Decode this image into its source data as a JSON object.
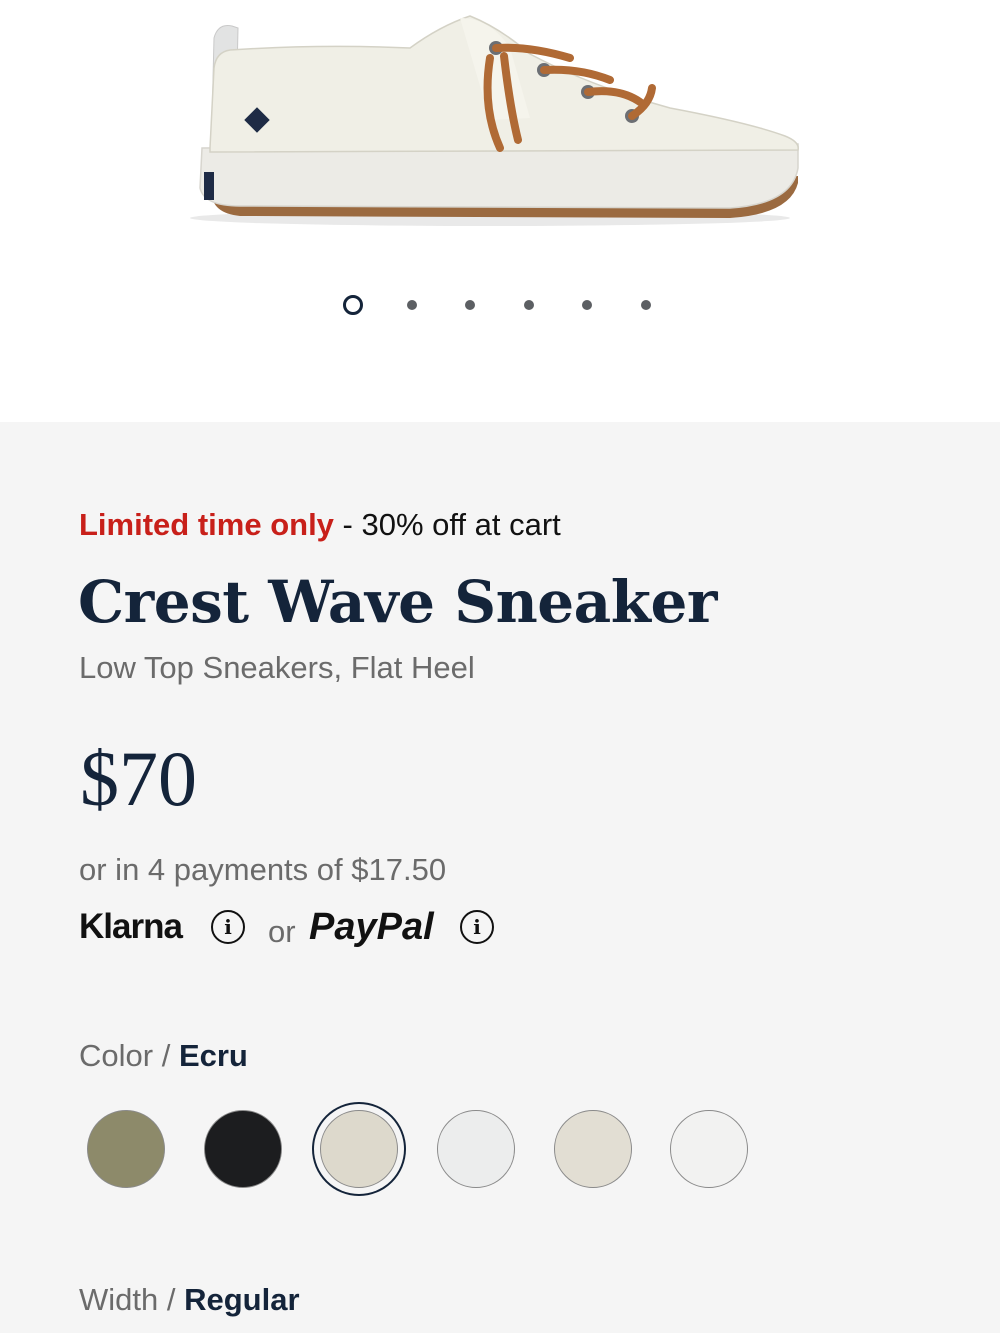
{
  "gallery": {
    "image_alt": "Crest Wave Sneaker in Ecru, side view",
    "dots": [
      {
        "active": true
      },
      {
        "active": false
      },
      {
        "active": false
      },
      {
        "active": false
      },
      {
        "active": false
      },
      {
        "active": false
      }
    ]
  },
  "promo": {
    "highlight": "Limited time only",
    "rest": " - 30% off at cart",
    "highlight_color": "#c8201a"
  },
  "product": {
    "title": "Crest Wave Sneaker",
    "subtitle": "Low Top Sneakers, Flat Heel",
    "price": "$70"
  },
  "payment": {
    "installments": "or in 4 payments of $17.50",
    "klarna_label": "Klarna",
    "or_text": "or",
    "paypal_label": "PayPal",
    "info_glyph": "i"
  },
  "color": {
    "label": "Color",
    "separator": " / ",
    "selected": "Ecru",
    "swatches": [
      {
        "name": "olive",
        "color": "#8d8a6a"
      },
      {
        "name": "black",
        "color": "#1c1d1f"
      },
      {
        "name": "ecru",
        "color": "#ddd9cc",
        "selected": true
      },
      {
        "name": "light-gray",
        "color": "#eceded"
      },
      {
        "name": "stone",
        "color": "#e2ded3"
      },
      {
        "name": "white",
        "color": "#f2f2f1"
      }
    ]
  },
  "width": {
    "label": "Width",
    "separator": " / ",
    "selected": "Regular"
  }
}
